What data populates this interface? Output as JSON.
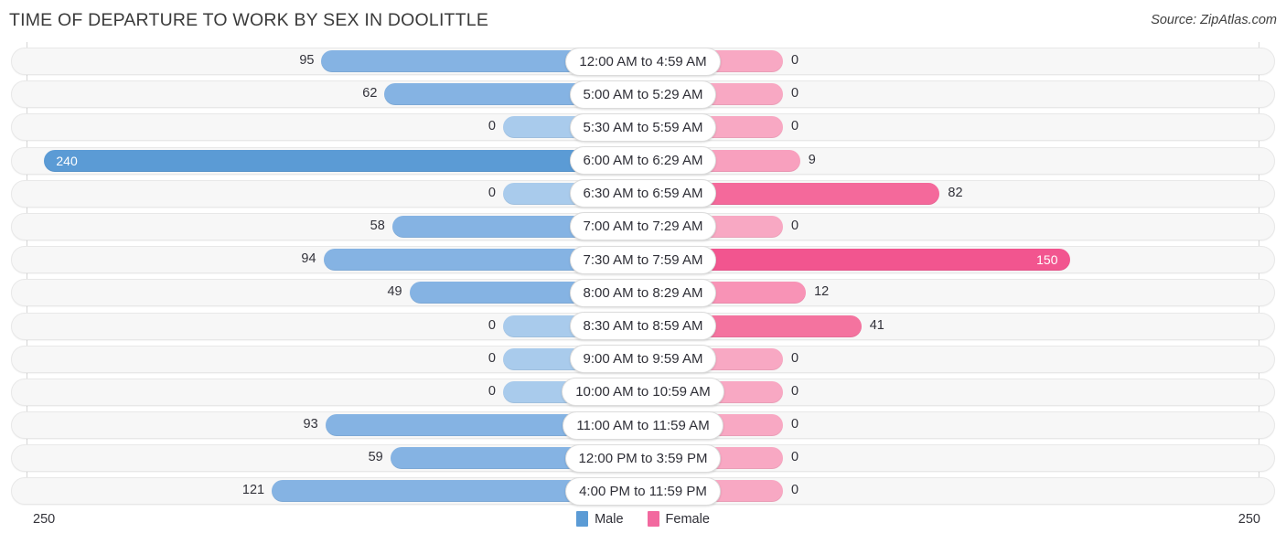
{
  "header": {
    "title": "TIME OF DEPARTURE TO WORK BY SEX IN DOOLITTLE",
    "source": "Source: ZipAtlas.com"
  },
  "axis": {
    "left_end_label": "250",
    "right_end_label": "250",
    "max": 250
  },
  "legend": {
    "items": [
      {
        "label": "Male",
        "color": "#5b9bd5"
      },
      {
        "label": "Female",
        "color": "#f2699f"
      }
    ]
  },
  "colors": {
    "male_light": "#85b3e3",
    "male_dark": "#5b9bd5",
    "female_light": "#f8a8c3",
    "female_mid": "#f783ad",
    "female_dark": "#f4699b",
    "track_bg": "#f7f7f7",
    "track_border": "#e8e8e8",
    "axis_line": "#d6d6d6",
    "text": "#32323a"
  },
  "chart_data": {
    "type": "bar",
    "orientation": "horizontal-diverging",
    "title": "TIME OF DEPARTURE TO WORK BY SEX IN DOOLITTLE",
    "xlabel": "",
    "ylabel": "",
    "xlim": [
      250,
      250
    ],
    "grid": false,
    "legend_position": "bottom-center",
    "categories": [
      "12:00 AM to 4:59 AM",
      "5:00 AM to 5:29 AM",
      "5:30 AM to 5:59 AM",
      "6:00 AM to 6:29 AM",
      "6:30 AM to 6:59 AM",
      "7:00 AM to 7:29 AM",
      "7:30 AM to 7:59 AM",
      "8:00 AM to 8:29 AM",
      "8:30 AM to 8:59 AM",
      "9:00 AM to 9:59 AM",
      "10:00 AM to 10:59 AM",
      "11:00 AM to 11:59 AM",
      "12:00 PM to 3:59 PM",
      "4:00 PM to 11:59 PM"
    ],
    "series": [
      {
        "name": "Male",
        "values": [
          95,
          62,
          0,
          240,
          0,
          58,
          94,
          49,
          0,
          0,
          0,
          93,
          59,
          121
        ]
      },
      {
        "name": "Female",
        "values": [
          0,
          0,
          0,
          9,
          82,
          0,
          150,
          12,
          41,
          0,
          0,
          0,
          0,
          0
        ]
      }
    ]
  },
  "rows": [
    {
      "label": "12:00 AM to 4:59 AM",
      "male": "95",
      "female": "0",
      "male_value": 95,
      "female_value": 0,
      "male_color": "#85b3e3",
      "female_color": "#f8a8c3",
      "male_inside": false,
      "female_inside": false
    },
    {
      "label": "5:00 AM to 5:29 AM",
      "male": "62",
      "female": "0",
      "male_value": 62,
      "female_value": 0,
      "male_color": "#85b3e3",
      "female_color": "#f8a8c3",
      "male_inside": false,
      "female_inside": false
    },
    {
      "label": "5:30 AM to 5:59 AM",
      "male": "0",
      "female": "0",
      "male_value": 0,
      "female_value": 0,
      "male_color": "#a9cbec",
      "female_color": "#f8a8c3",
      "male_inside": false,
      "female_inside": false
    },
    {
      "label": "6:00 AM to 6:29 AM",
      "male": "240",
      "female": "9",
      "male_value": 240,
      "female_value": 9,
      "male_color": "#5b9bd5",
      "female_color": "#f8a0be",
      "male_inside": true,
      "female_inside": false
    },
    {
      "label": "6:30 AM to 6:59 AM",
      "male": "0",
      "female": "82",
      "male_value": 0,
      "female_value": 82,
      "male_color": "#a9cbec",
      "female_color": "#f4699b",
      "male_inside": false,
      "female_inside": false
    },
    {
      "label": "7:00 AM to 7:29 AM",
      "male": "58",
      "female": "0",
      "male_value": 58,
      "female_value": 0,
      "male_color": "#85b3e3",
      "female_color": "#f8a8c3",
      "male_inside": false,
      "female_inside": false
    },
    {
      "label": "7:30 AM to 7:59 AM",
      "male": "94",
      "female": "150",
      "male_value": 94,
      "female_value": 150,
      "male_color": "#85b3e3",
      "female_color": "#f2558f",
      "male_inside": false,
      "female_inside": true
    },
    {
      "label": "8:00 AM to 8:29 AM",
      "male": "49",
      "female": "12",
      "male_value": 49,
      "female_value": 12,
      "male_color": "#85b3e3",
      "female_color": "#f893b6",
      "male_inside": false,
      "female_inside": false
    },
    {
      "label": "8:30 AM to 8:59 AM",
      "male": "0",
      "female": "41",
      "male_value": 0,
      "female_value": 41,
      "male_color": "#a9cbec",
      "female_color": "#f4739f",
      "male_inside": false,
      "female_inside": false
    },
    {
      "label": "9:00 AM to 9:59 AM",
      "male": "0",
      "female": "0",
      "male_value": 0,
      "female_value": 0,
      "male_color": "#a9cbec",
      "female_color": "#f8a8c3",
      "male_inside": false,
      "female_inside": false
    },
    {
      "label": "10:00 AM to 10:59 AM",
      "male": "0",
      "female": "0",
      "male_value": 0,
      "female_value": 0,
      "male_color": "#a9cbec",
      "female_color": "#f8a8c3",
      "male_inside": false,
      "female_inside": false
    },
    {
      "label": "11:00 AM to 11:59 AM",
      "male": "93",
      "female": "0",
      "male_value": 93,
      "female_value": 0,
      "male_color": "#85b3e3",
      "female_color": "#f8a8c3",
      "male_inside": false,
      "female_inside": false
    },
    {
      "label": "12:00 PM to 3:59 PM",
      "male": "59",
      "female": "0",
      "male_value": 59,
      "female_value": 0,
      "male_color": "#85b3e3",
      "female_color": "#f8a8c3",
      "male_inside": false,
      "female_inside": false
    },
    {
      "label": "4:00 PM to 11:59 PM",
      "male": "121",
      "female": "0",
      "male_value": 121,
      "female_value": 0,
      "male_color": "#85b3e3",
      "female_color": "#f8a8c3",
      "male_inside": false,
      "female_inside": false
    }
  ]
}
